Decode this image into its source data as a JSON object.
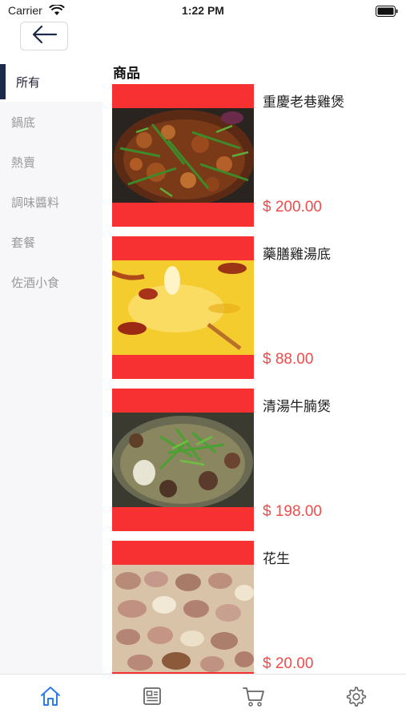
{
  "status_bar": {
    "carrier": "Carrier",
    "time": "1:22 PM"
  },
  "page": {
    "section_title": "商品"
  },
  "categories": [
    {
      "label": "所有",
      "active": true
    },
    {
      "label": "鍋底",
      "active": false
    },
    {
      "label": "熱賣",
      "active": false
    },
    {
      "label": "調味醬料",
      "active": false
    },
    {
      "label": "套餐",
      "active": false
    },
    {
      "label": "佐酒小食",
      "active": false
    }
  ],
  "products": [
    {
      "name": "重慶老巷雞煲",
      "price": "$ 200.00"
    },
    {
      "name": "藥膳雞湯底",
      "price": "$ 88.00"
    },
    {
      "name": "清湯牛腩煲",
      "price": "$ 198.00"
    },
    {
      "name": "花生",
      "price": "$ 20.00"
    }
  ],
  "tab_bar": [
    {
      "icon": "home-icon",
      "active": true
    },
    {
      "icon": "news-icon",
      "active": false
    },
    {
      "icon": "cart-icon",
      "active": false
    },
    {
      "icon": "settings-icon",
      "active": false
    }
  ],
  "colors": {
    "accent_red": "#f73131",
    "price_red": "#ef4b4b",
    "active_tab": "#2b7de9",
    "sidebar_indicator": "#1e2a4a"
  }
}
